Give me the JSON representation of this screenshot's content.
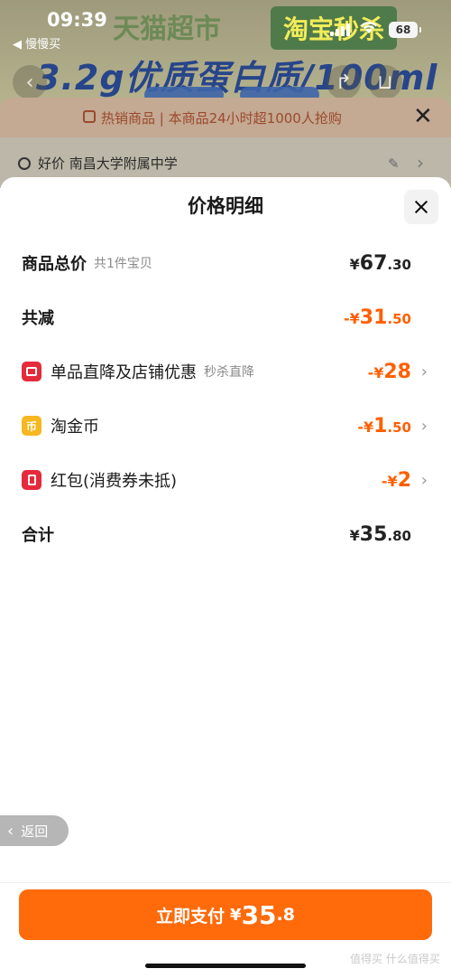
{
  "status_bar": {
    "time": "09:39",
    "back_app": "◀ 慢慢买",
    "battery": "68"
  },
  "background": {
    "banner_left": "天猫超市",
    "banner_right": "淘宝秒杀",
    "headline": "3.2g优质蛋白质/100ml",
    "hot_text": "热销商品 | 本商品24小时超1000人抢购",
    "address": "好价 南昌大学附属中学"
  },
  "sheet": {
    "title": "价格明细",
    "rows": [
      {
        "label": "商品总价",
        "sub": "共1件宝贝",
        "yen": "¥",
        "int": "67",
        "dec": ".30",
        "sign": ""
      },
      {
        "label": "共减",
        "sub": "",
        "yen": "¥",
        "int": "31",
        "dec": ".50",
        "sign": "-"
      },
      {
        "label": "单品直降及店铺优惠",
        "sub": "秒杀直降",
        "yen": "¥",
        "int": "28",
        "dec": "",
        "sign": "-"
      },
      {
        "label": "淘金币",
        "sub": "",
        "yen": "¥",
        "int": "1",
        "dec": ".50",
        "sign": "-"
      },
      {
        "label": "红包(消费券未抵)",
        "sub": "",
        "yen": "¥",
        "int": "2",
        "dec": "",
        "sign": "-"
      },
      {
        "label": "合计",
        "sub": "",
        "yen": "¥",
        "int": "35",
        "dec": ".80",
        "sign": ""
      }
    ],
    "icon_coin_glyph": "币"
  },
  "back_label": "返回",
  "pay_button": {
    "label": "立即支付",
    "yen": "¥",
    "int": "35",
    "dec": ".8"
  },
  "watermark": "值得买 什么值得买",
  "colors": {
    "accent_orange": "#ff6a0b",
    "discount_orange": "#ff5f00",
    "icon_red": "#e52a3c",
    "icon_yellow": "#f6b71f"
  }
}
